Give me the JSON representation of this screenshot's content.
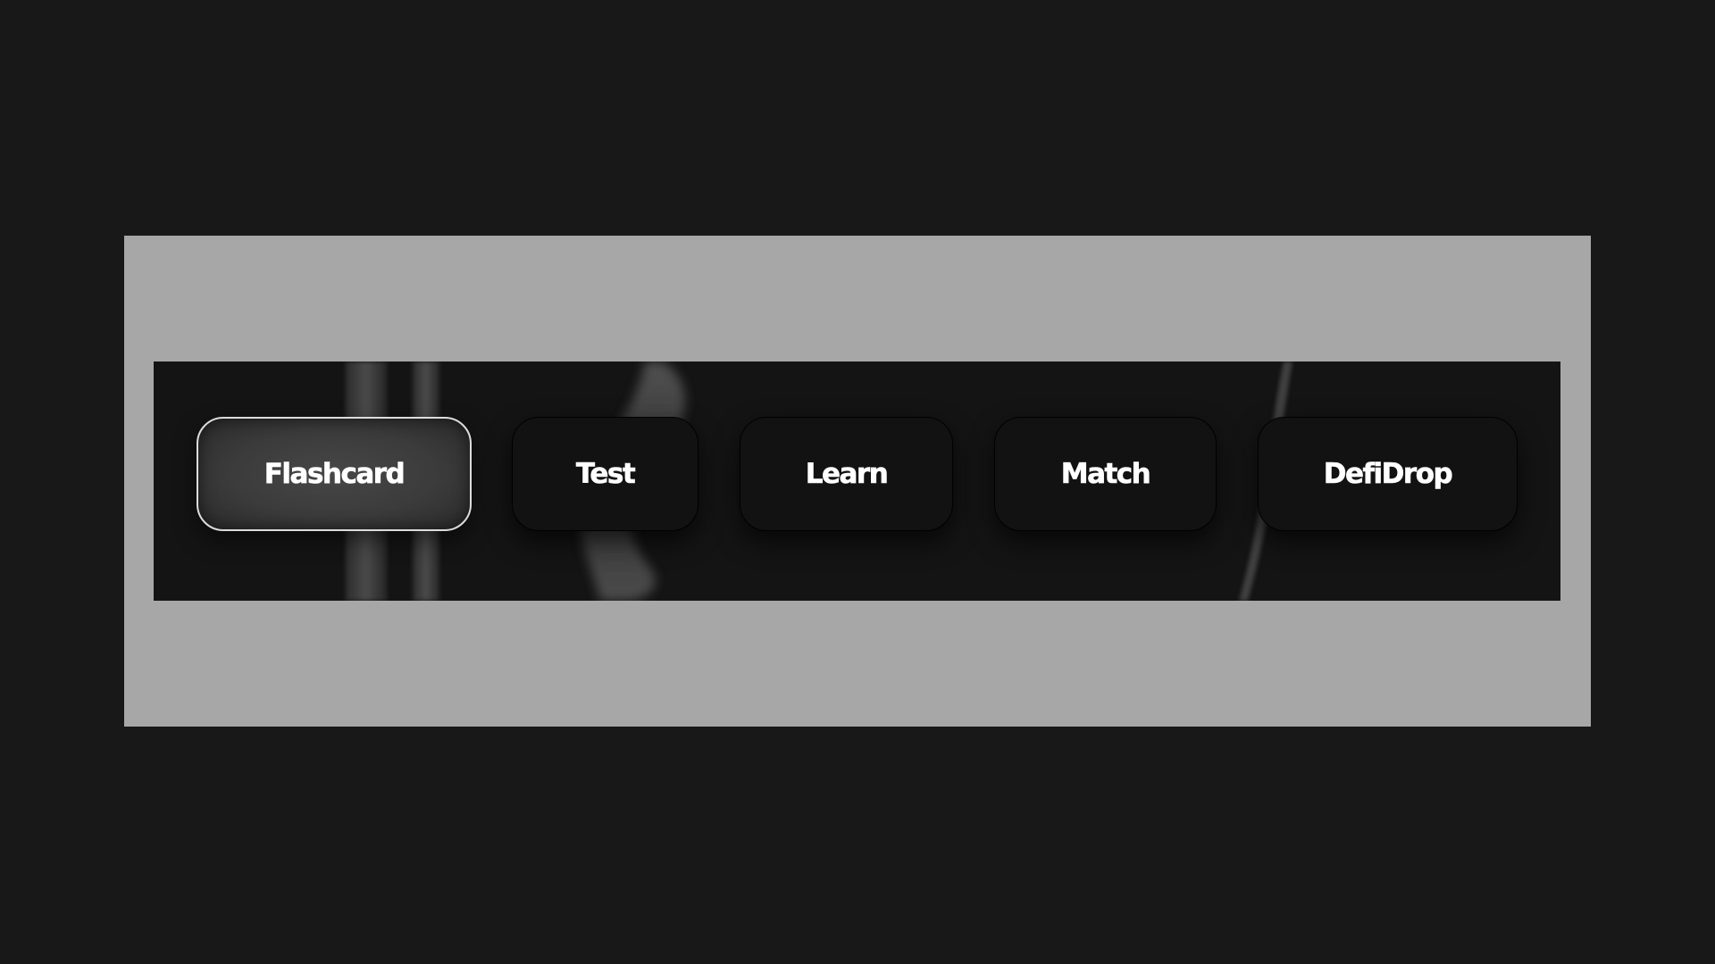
{
  "colors": {
    "page_background": "#181818",
    "frame_background": "#a7a7a7",
    "banner_background": "#141414",
    "tab_background": "#121212",
    "active_tab_background": "#3f3f3f",
    "active_tab_border": "#dcdcdc",
    "label_color": "#ffffff"
  },
  "tabs": [
    {
      "label": "Flashcard",
      "active": true
    },
    {
      "label": "Test",
      "active": false
    },
    {
      "label": "Learn",
      "active": false
    },
    {
      "label": "Match",
      "active": false
    },
    {
      "label": "DefiDrop",
      "active": false
    }
  ]
}
